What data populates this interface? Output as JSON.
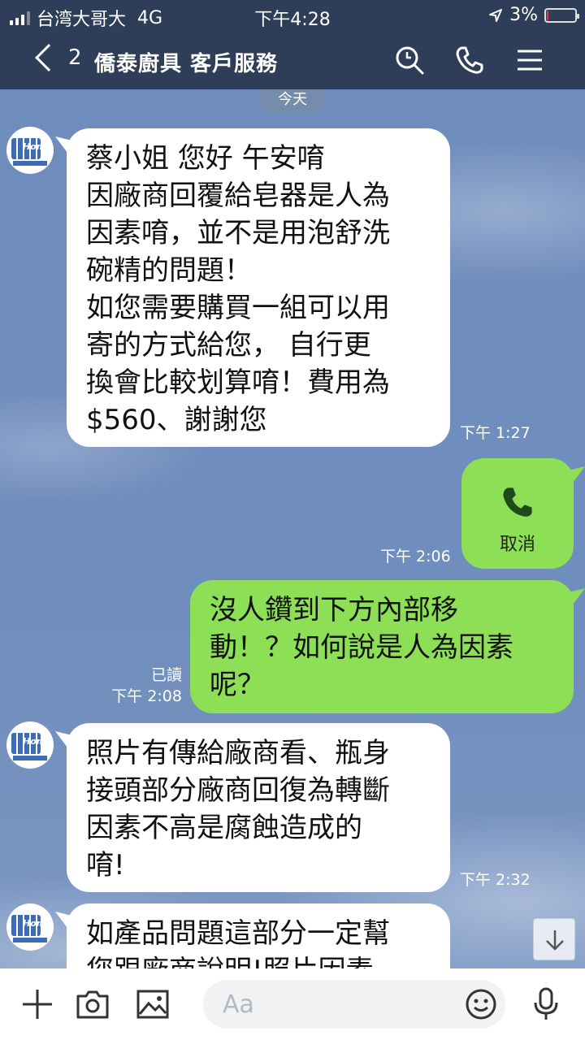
{
  "status": {
    "carrier": "台湾大哥大",
    "network": "4G",
    "time": "下午4:28",
    "battery": "3%",
    "battery_level": 0.03
  },
  "header": {
    "back_count": "2",
    "title": "僑泰廚具 客戶服務",
    "icons": [
      "search-icon",
      "phone-icon",
      "menu-icon"
    ]
  },
  "chat": {
    "date_label": "今天",
    "messages": [
      {
        "side": "in",
        "lines": [
          "蔡小姐 您好 午安唷",
          "因廠商回覆給皂器是人為",
          "因素唷，並不是用泡舒洗",
          "碗精的問題！",
          "如您需要購買一組可以用",
          "寄的方式給您， 自行更",
          "換會比較划算唷！費用為",
          "$560、謝謝您"
        ],
        "time": "下午 1:27"
      },
      {
        "side": "out",
        "type": "call",
        "label": "取消",
        "time": "下午 2:06"
      },
      {
        "side": "out",
        "lines": [
          "沒人鑽到下方內部移",
          "動！？如何說是人為因素",
          "呢？"
        ],
        "read": "已讀",
        "time": "下午 2:08"
      },
      {
        "side": "in",
        "lines": [
          "照片有傳給廠商看、瓶身",
          "接頭部分廠商回復為轉斷",
          "因素不高是腐蝕造成的",
          "唷!"
        ],
        "time": "下午 2:32"
      },
      {
        "side": "in",
        "lines": [
          "如產品問題這部分一定幫",
          "您跟廠商說明!照片因素"
        ]
      }
    ],
    "avatar_label": "Home"
  },
  "input": {
    "placeholder": "Aa",
    "icons": [
      "plus-icon",
      "camera-icon",
      "image-icon",
      "emoji-icon",
      "microphone-icon"
    ]
  },
  "colors": {
    "header_bg": "#2f3e58",
    "out_bubble": "#8de055",
    "in_bubble": "#ffffff",
    "chat_bg": "#6f8fbf"
  }
}
